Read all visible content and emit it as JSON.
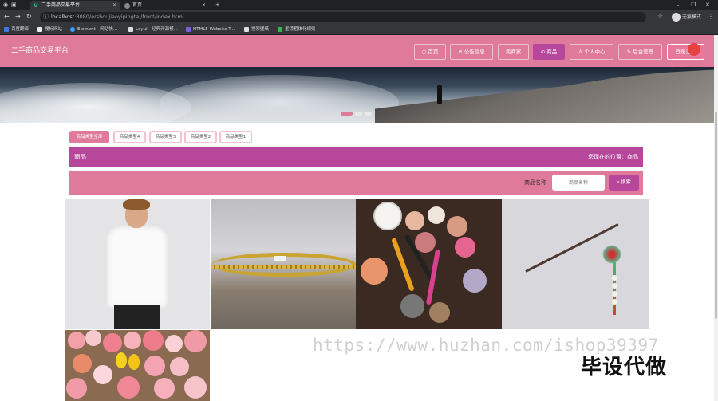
{
  "browser": {
    "tabs": [
      {
        "title": "二手商品交易平台",
        "icon": "vue-icon"
      },
      {
        "title": "首页",
        "icon": "globe-icon"
      }
    ],
    "url_host": "localhost",
    "url_rest": ":8080/ershoujiaoyipingtai/front/index.html",
    "profile_label": "无痕模式",
    "bookmarks": [
      "百度翻译",
      "搜标网站",
      "Element - 网站快...",
      "Layui - 经典开源模...",
      "HTML5 Website T...",
      "搜索壁纸",
      "墨镜粗体化规则"
    ]
  },
  "site": {
    "title": "二手商品交易平台",
    "nav": [
      "首页",
      "公告信息",
      "卖商家",
      "商品",
      "个人中心",
      "后台管理",
      "登录注册"
    ],
    "active_nav": "商品"
  },
  "categories": {
    "items": [
      "商品类型全部",
      "商品类型4",
      "商品类型3",
      "商品类型2",
      "商品类型1"
    ],
    "active": "商品类型全部"
  },
  "breadcrumb": {
    "label": "商品",
    "location": "您现在的位置：商品"
  },
  "search": {
    "label": "商品名称",
    "placeholder": "商品名称",
    "button": "搜索"
  },
  "products": [
    "shirt",
    "gold-necklace",
    "makeup-palette",
    "hairpin",
    "flowers"
  ],
  "watermark": {
    "url": "https://www.huzhan.com/ishop39397",
    "text": "毕设代做"
  },
  "colors": {
    "header": "#e07a9a",
    "accent": "#b7479a"
  }
}
